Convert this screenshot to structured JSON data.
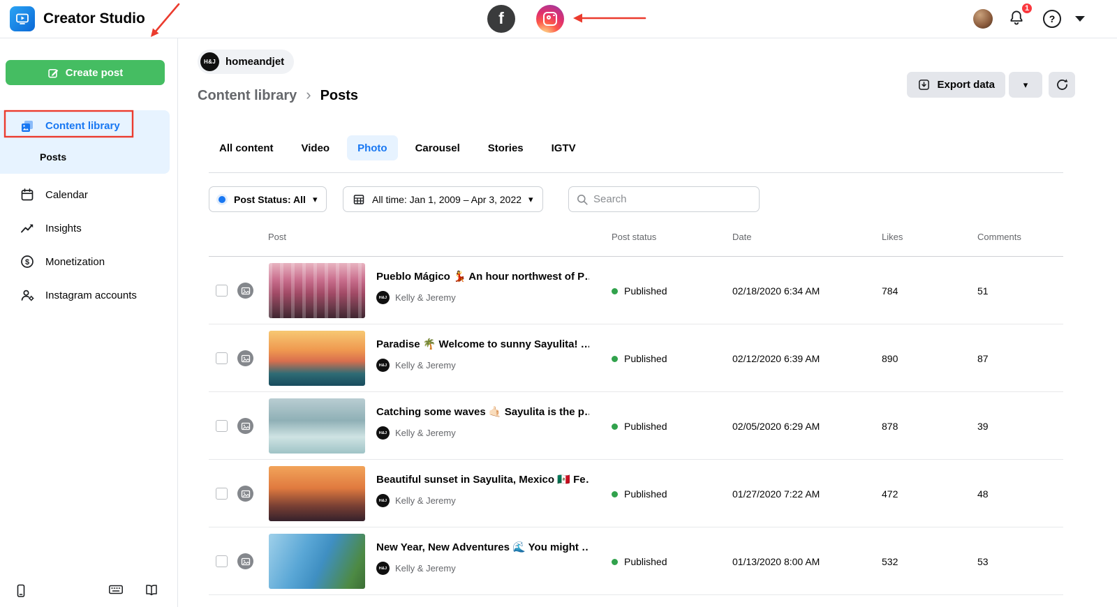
{
  "colors": {
    "brand_blue": "#1877F2",
    "create_green": "#45BD62",
    "published_green": "#31A24C",
    "annotation_red": "#EB3B2E"
  },
  "icons": {
    "caret_down": "▾",
    "breadcrumb_chevron": "›",
    "facebook_f": "f",
    "help_mark": "?",
    "dollar": "$"
  },
  "topbar": {
    "app_title": "Creator Studio",
    "notification_count": "1"
  },
  "account": {
    "name": "homeandjet",
    "initials": "H&J"
  },
  "sidebar": {
    "create_post": "Create post",
    "content_library": "Content library",
    "posts": "Posts",
    "items": [
      {
        "label": "Calendar"
      },
      {
        "label": "Insights"
      },
      {
        "label": "Monetization"
      },
      {
        "label": "Instagram accounts"
      }
    ]
  },
  "breadcrumb": {
    "parent": "Content library",
    "current": "Posts"
  },
  "actions": {
    "export": "Export data"
  },
  "tabs": [
    {
      "label": "All content"
    },
    {
      "label": "Video"
    },
    {
      "label": "Photo"
    },
    {
      "label": "Carousel"
    },
    {
      "label": "Stories"
    },
    {
      "label": "IGTV"
    }
  ],
  "filters": {
    "post_status": "Post Status: All",
    "date_range": "All time: Jan 1, 2009 – Apr 3, 2022",
    "search_placeholder": "Search"
  },
  "table": {
    "columns": [
      "Post",
      "Post status",
      "Date",
      "Likes",
      "Comments"
    ],
    "rows": [
      {
        "title": "Pueblo Mágico 💃 An hour northwest of P…",
        "author": "Kelly & Jeremy",
        "status": "Published",
        "date": "02/18/2020 6:34 AM",
        "likes": "784",
        "comments": "51"
      },
      {
        "title": "Paradise 🌴 Welcome to sunny Sayulita! …",
        "author": "Kelly & Jeremy",
        "status": "Published",
        "date": "02/12/2020 6:39 AM",
        "likes": "890",
        "comments": "87"
      },
      {
        "title": "Catching some waves 🤙🏻 Sayulita is the p…",
        "author": "Kelly & Jeremy",
        "status": "Published",
        "date": "02/05/2020 6:29 AM",
        "likes": "878",
        "comments": "39"
      },
      {
        "title": "Beautiful sunset in Sayulita, Mexico 🇲🇽 Fe…",
        "author": "Kelly & Jeremy",
        "status": "Published",
        "date": "01/27/2020 7:22 AM",
        "likes": "472",
        "comments": "48"
      },
      {
        "title": "New Year, New Adventures 🌊 You might …",
        "author": "Kelly & Jeremy",
        "status": "Published",
        "date": "01/13/2020 8:00 AM",
        "likes": "532",
        "comments": "53"
      }
    ]
  }
}
